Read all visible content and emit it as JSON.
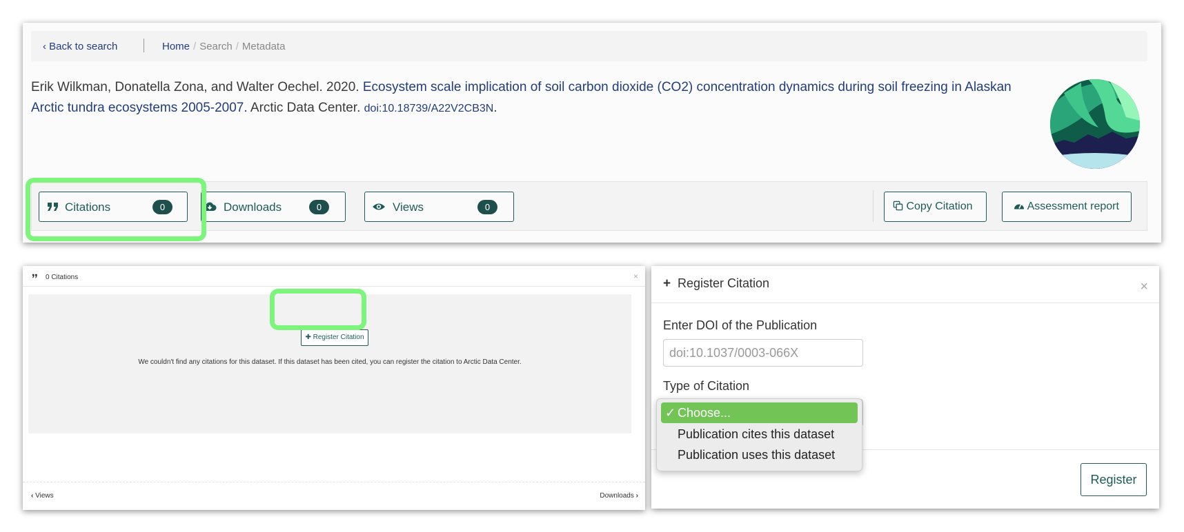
{
  "top_panel": {
    "back_link": "‹ Back to search",
    "breadcrumbs": {
      "home": "Home",
      "search": "Search",
      "metadata": "Metadata",
      "separator": "/"
    },
    "citation": {
      "authors_year": "Erik Wilkman, Donatella Zona, and Walter Oechel. 2020. ",
      "title": "Ecosystem scale implication of soil carbon dioxide (CO2) concentration dynamics during soil freezing in Alaskan Arctic tundra ecosystems 2005-2007.",
      "publisher": " Arctic Data Center. ",
      "doi": "doi:10.18739/A22V2CB3N",
      "doi_suffix": "."
    },
    "metrics": {
      "citations_label": "Citations",
      "citations_count": "0",
      "downloads_label": "Downloads",
      "downloads_count": "0",
      "views_label": "Views",
      "views_count": "0"
    },
    "actions": {
      "copy_citation": "Copy Citation",
      "assessment_report": "Assessment report"
    }
  },
  "citations_modal": {
    "title": "0 Citations",
    "close": "×",
    "register_button": "✚ Register Citation",
    "empty_message": "We couldn't find any citations for this dataset. If this dataset has been cited, you can register the citation to Arctic Data Center.",
    "nav_prev": "Views",
    "nav_next": "Downloads"
  },
  "register_modal": {
    "title": "Register Citation",
    "close": "×",
    "doi_label": "Enter DOI of the Publication",
    "doi_placeholder": "doi:10.1037/0003-066X",
    "type_label": "Type of Citation",
    "type_options": [
      "Choose...",
      "Publication cites this dataset",
      "Publication uses this dataset"
    ],
    "selected_index": 0,
    "register_button": "Register"
  },
  "colors": {
    "accent": "#1f5a57",
    "link": "#233c7a",
    "highlight": "#7df57c",
    "selected_option": "#72c456"
  },
  "icons": [
    "quote-icon",
    "download-cloud-icon",
    "eye-icon",
    "copy-icon",
    "gauge-icon",
    "plus-icon",
    "close-icon",
    "chevron-left-icon",
    "chevron-right-icon",
    "checkmark-icon"
  ]
}
